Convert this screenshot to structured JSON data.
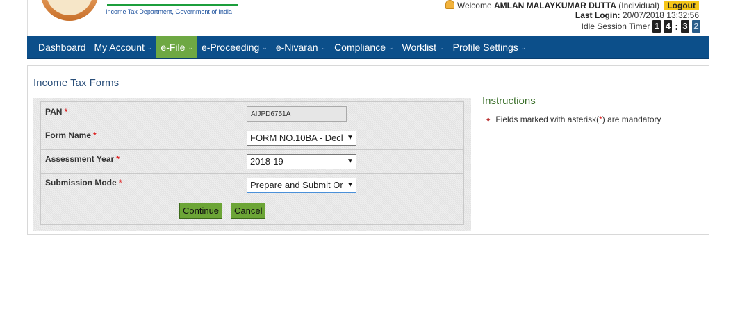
{
  "header": {
    "department": "Income Tax Department, Government of India",
    "welcome_prefix": "Welcome",
    "user_name": "AMLAN MALAYKUMAR DUTTA",
    "user_type": "(Individual)",
    "logout_label": "Logout",
    "last_login_label": "Last Login:",
    "last_login_value": "20/07/2018 13:32:56",
    "idle_timer_label": "Idle Session Timer",
    "timer_digits": [
      "1",
      "4",
      "3",
      "2"
    ]
  },
  "nav": {
    "items": [
      {
        "label": "Dashboard",
        "caret": ""
      },
      {
        "label": "My Account",
        "caret": "⌄"
      },
      {
        "label": "e-File",
        "caret": "⌄"
      },
      {
        "label": "e-Proceeding",
        "caret": "⌄"
      },
      {
        "label": "e-Nivaran",
        "caret": "⌄"
      },
      {
        "label": "Compliance",
        "caret": "⌄"
      },
      {
        "label": "Worklist",
        "caret": "⌄"
      },
      {
        "label": "Profile Settings",
        "caret": "⌄"
      }
    ],
    "active_index": 2
  },
  "form": {
    "title": "Income Tax Forms",
    "pan_label": "PAN",
    "pan_value": "AIJPD6751A",
    "form_name_label": "Form Name",
    "form_name_value": "FORM NO.10BA - Decl",
    "assessment_year_label": "Assessment Year",
    "assessment_year_value": "2018-19",
    "submission_mode_label": "Submission Mode",
    "submission_mode_value": "Prepare and Submit Or",
    "required_marker": "*",
    "continue_label": "Continue",
    "cancel_label": "Cancel"
  },
  "instructions": {
    "title": "Instructions",
    "item_prefix": "Fields marked with asterisk(",
    "item_marker": "*",
    "item_suffix": ") are mandatory"
  },
  "colors": {
    "nav_bg": "#0c4f8a",
    "nav_active": "#6ea843",
    "button_green": "#6ca536",
    "logout_yellow": "#f5c518",
    "required_red": "#d22222"
  }
}
